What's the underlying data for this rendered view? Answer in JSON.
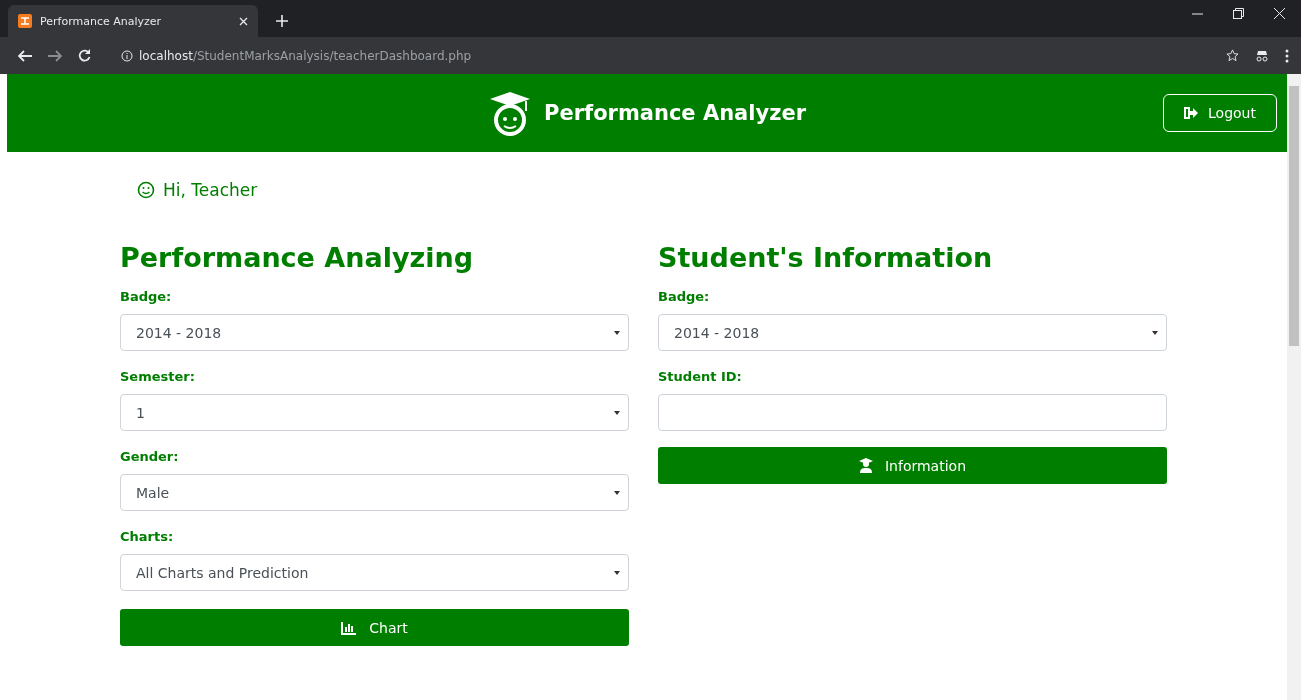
{
  "browser": {
    "tab_title": "Performance Analyzer",
    "url_host": "localhost",
    "url_path": "/StudentMarksAnalysis/teacherDashboard.php"
  },
  "header": {
    "title": "Performance Analyzer",
    "logout": "Logout"
  },
  "greeting": "Hi, Teacher",
  "panels": [
    {
      "title": "Performance Analyzing",
      "fields": [
        {
          "kind": "select",
          "label": "Badge:",
          "value": "2014 - 2018"
        },
        {
          "kind": "select",
          "label": "Semester:",
          "value": "1"
        },
        {
          "kind": "select",
          "label": "Gender:",
          "value": "Male"
        },
        {
          "kind": "select",
          "label": "Charts:",
          "value": "All Charts and Prediction"
        }
      ],
      "button": {
        "kind": "chart",
        "label": "Chart"
      }
    },
    {
      "title": "Student's Information",
      "fields": [
        {
          "kind": "select",
          "label": "Badge:",
          "value": "2014 - 2018"
        },
        {
          "kind": "input",
          "label": "Student ID:"
        }
      ],
      "button": {
        "kind": "student",
        "label": "Information"
      }
    }
  ]
}
